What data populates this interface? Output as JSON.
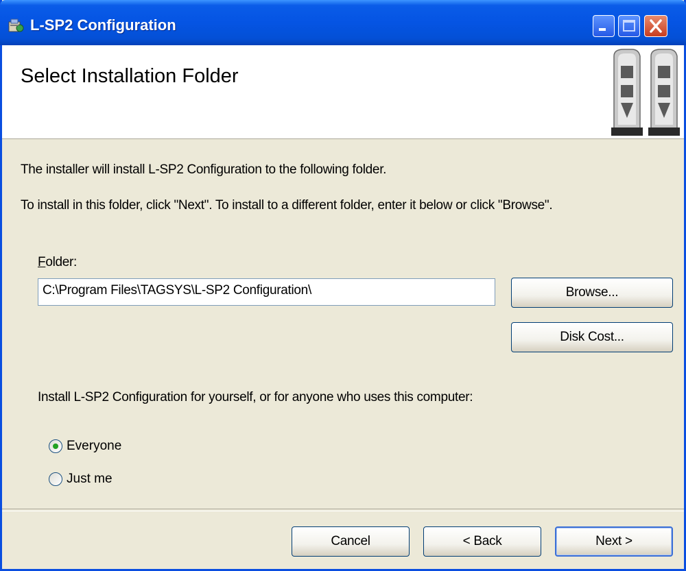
{
  "window": {
    "title": "L-SP2 Configuration",
    "controls": {
      "minimize": "minimize",
      "maximize": "maximize",
      "close": "close"
    }
  },
  "header": {
    "title": "Select Installation Folder",
    "graphic_icon": "security-gate-icon"
  },
  "body": {
    "intro": "The installer will install L-SP2 Configuration to the following folder.",
    "instruction": "To install in this folder, click \"Next\". To install to a different folder, enter it below or click \"Browse\".",
    "folder_label_accel": "F",
    "folder_label_rest": "older:",
    "folder_value": "C:\\Program Files\\TAGSYS\\L-SP2 Configuration\\",
    "browse_label": "Browse...",
    "disk_cost_label": "Disk Cost...",
    "scope_prompt": "Install L-SP2 Configuration for yourself, or for anyone who uses this computer:",
    "options": [
      {
        "label": "Everyone",
        "selected": true
      },
      {
        "label": "Just me",
        "selected": false
      }
    ]
  },
  "footer": {
    "cancel_label": "Cancel",
    "back_label": "< Back",
    "next_label": "Next >"
  },
  "colors": {
    "titlebar": "#0554e3",
    "dialog_bg": "#ece9d8",
    "radio_selected": "#21a121"
  }
}
